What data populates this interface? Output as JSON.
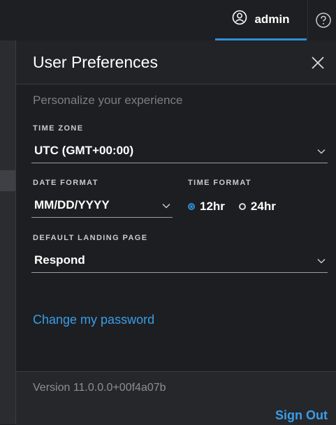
{
  "topbar": {
    "username": "admin",
    "user_icon": "user-circle-icon",
    "help_icon": "question-circle-icon"
  },
  "panel": {
    "title": "User Preferences",
    "subtitle": "Personalize your experience",
    "close_icon": "close-icon"
  },
  "fields": {
    "time_zone": {
      "label": "TIME ZONE",
      "value": "UTC (GMT+00:00)"
    },
    "date_format": {
      "label": "DATE FORMAT",
      "value": "MM/DD/YYYY"
    },
    "time_format": {
      "label": "TIME FORMAT",
      "options": [
        {
          "label": "12hr",
          "selected": true
        },
        {
          "label": "24hr",
          "selected": false
        }
      ]
    },
    "landing_page": {
      "label": "DEFAULT LANDING PAGE",
      "value": "Respond"
    }
  },
  "links": {
    "change_password": "Change my password"
  },
  "footer": {
    "version": "Version 11.0.0.0+00f4a07b",
    "sign_out": "Sign Out"
  },
  "colors": {
    "accent": "#2f8fd8",
    "link": "#3a9de8",
    "panel_bg": "#1d1e21"
  }
}
